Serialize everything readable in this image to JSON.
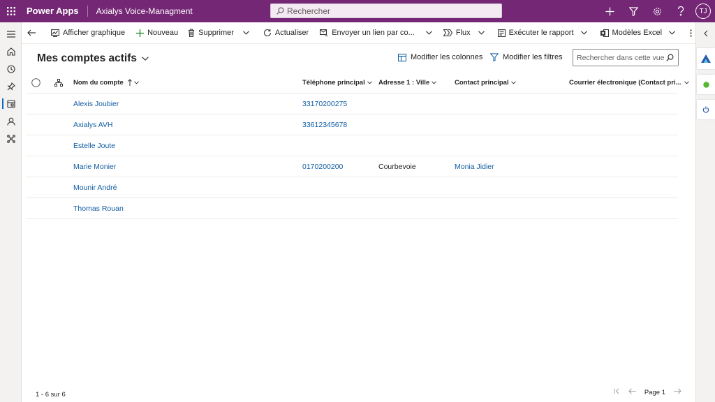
{
  "topbar": {
    "app_name": "Power Apps",
    "environment": "Axialys Voice-Managment",
    "search_placeholder": "Rechercher",
    "user_initials": "TJ"
  },
  "leftnav": {
    "icons": [
      "menu-icon",
      "home-icon",
      "recent-icon",
      "pin-icon",
      "accounts-icon",
      "contacts-icon",
      "connections-icon"
    ],
    "active": "accounts-icon"
  },
  "commandbar": {
    "show_chart": "Afficher graphique",
    "new": "Nouveau",
    "delete": "Supprimer",
    "refresh": "Actualiser",
    "email_link": "Envoyer un lien par co...",
    "flow": "Flux",
    "run_report": "Exécuter le rapport",
    "excel_templates": "Modèles Excel"
  },
  "view": {
    "title": "Mes comptes actifs",
    "edit_columns": "Modifier les colonnes",
    "edit_filters": "Modifier les filtres",
    "search_placeholder": "Rechercher dans cette vue"
  },
  "grid": {
    "columns": {
      "name": "Nom du compte",
      "phone": "Téléphone principal",
      "city": "Adresse 1 : Ville",
      "contact": "Contact principal",
      "email": "Courrier électronique (Contact pri..."
    },
    "rows": [
      {
        "name": "Alexis Joubier",
        "phone": "33170200275",
        "city": "",
        "contact": ""
      },
      {
        "name": "Axialys AVH",
        "phone": "33612345678",
        "city": "",
        "contact": ""
      },
      {
        "name": "Estelle Joute",
        "phone": "",
        "city": "",
        "contact": ""
      },
      {
        "name": "Marie Monier",
        "phone": "0170200200",
        "city": "Courbevoie",
        "contact": "Monia Jidier"
      },
      {
        "name": "Mounir André",
        "phone": "",
        "city": "",
        "contact": ""
      },
      {
        "name": "Thomas Rouan",
        "phone": "",
        "city": "",
        "contact": ""
      }
    ]
  },
  "footer": {
    "count": "1 - 6 sur 6",
    "page": "Page 1"
  },
  "colors": {
    "brand": "#742774",
    "link": "#115ea3",
    "status_green": "#57b730"
  }
}
